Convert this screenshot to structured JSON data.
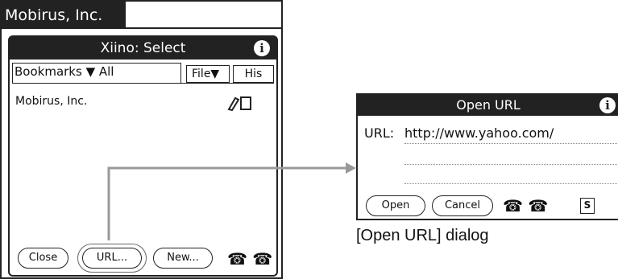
{
  "app": {
    "title": "Mobirus, Inc."
  },
  "select_window": {
    "title": "Xiino: Select",
    "info_glyph": "i",
    "bookmarks_label": "Bookmarks ▼ All",
    "file_menu": "File▼",
    "history_tab": "His",
    "items": [
      {
        "label": "Mobirus, Inc."
      }
    ],
    "buttons": {
      "close": "Close",
      "url": "URL...",
      "new": "New..."
    },
    "phone_icons": "☎ ☎"
  },
  "open_url_dialog": {
    "title": "Open URL",
    "info_glyph": "i",
    "url_label": "URL:",
    "url_value": "http://www.yahoo.com/",
    "buttons": {
      "open": "Open",
      "cancel": "Cancel"
    },
    "phone_icons": "☎ ☎",
    "shortcut_glyph": "S"
  },
  "caption": "[Open URL] dialog",
  "colors": {
    "titlebar": "#222222",
    "connector": "#999999"
  }
}
